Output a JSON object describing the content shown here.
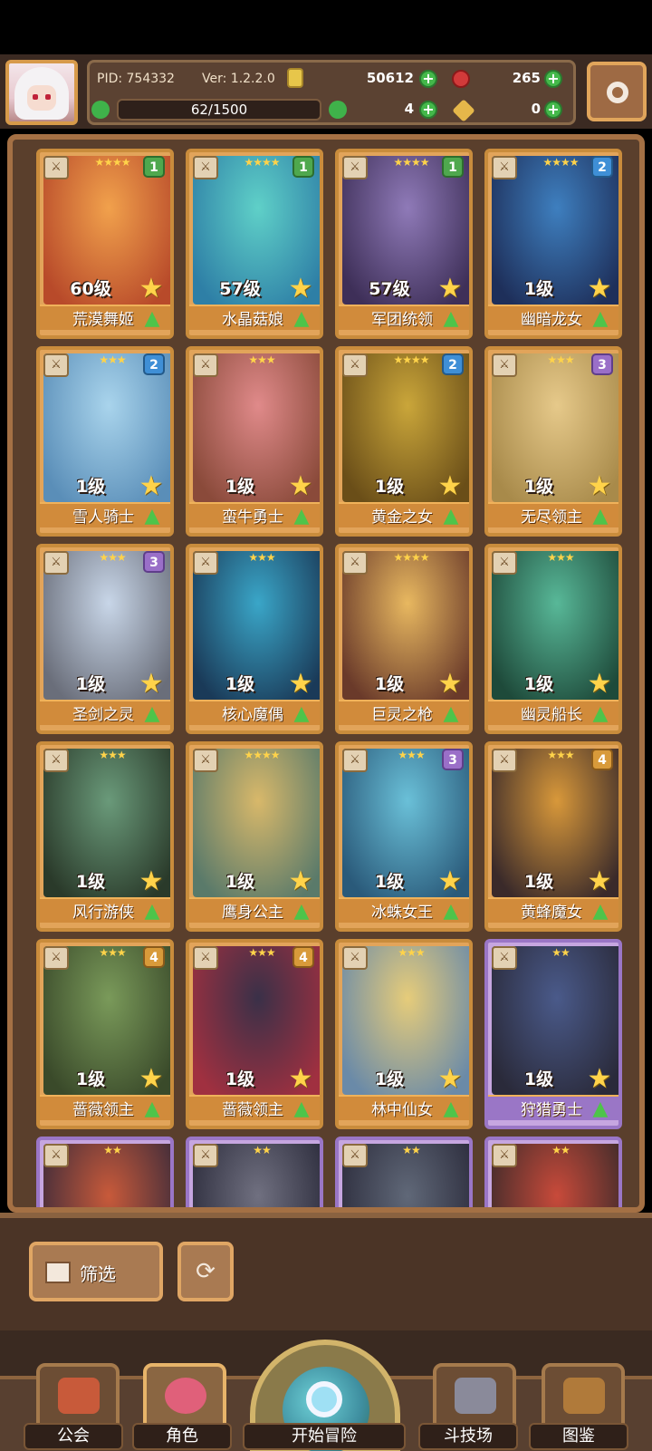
{
  "player": {
    "pid": "PID: 754332",
    "version": "Ver: 1.2.2.0",
    "coins": "50612",
    "gems": "265",
    "stamina": "62/1500",
    "clovers": "4",
    "keys": "0"
  },
  "icons": {
    "settings": "gear-icon",
    "coin": "gold-coin-icon",
    "gem": "red-gem-icon",
    "clover": "clover-icon",
    "key": "key-icon"
  },
  "colors": {
    "card_gold_border": "#c98c3c",
    "card_purple_border": "#9a76c6",
    "badge_green": "#4fa84e",
    "badge_blue": "#3f8fd6",
    "badge_purple": "#9a6fc8",
    "badge_gold": "#d89a3a"
  },
  "cards": [
    {
      "level": "60级",
      "name": "荒漠舞姬",
      "stars": "★★★★",
      "badge": "1",
      "rarity": "gold"
    },
    {
      "level": "57级",
      "name": "水晶菇娘",
      "stars": "★★★★",
      "badge": "1",
      "rarity": "gold"
    },
    {
      "level": "57级",
      "name": "军团统领",
      "stars": "★★★★",
      "badge": "1",
      "rarity": "gold"
    },
    {
      "level": "1级",
      "name": "幽暗龙女",
      "stars": "★★★★",
      "badge": "2",
      "rarity": "gold"
    },
    {
      "level": "1级",
      "name": "雪人骑士",
      "stars": "★★★",
      "badge": "2",
      "rarity": "gold"
    },
    {
      "level": "1级",
      "name": "蛮牛勇士",
      "stars": "★★★",
      "badge": "",
      "rarity": "gold"
    },
    {
      "level": "1级",
      "name": "黄金之女",
      "stars": "★★★★",
      "badge": "2",
      "rarity": "gold"
    },
    {
      "level": "1级",
      "name": "无尽领主",
      "stars": "★★★",
      "badge": "3",
      "rarity": "gold"
    },
    {
      "level": "1级",
      "name": "圣剑之灵",
      "stars": "★★★",
      "badge": "3",
      "rarity": "gold"
    },
    {
      "level": "1级",
      "name": "核心魔偶",
      "stars": "★★★",
      "badge": "",
      "rarity": "gold"
    },
    {
      "level": "1级",
      "name": "巨灵之枪",
      "stars": "★★★★",
      "badge": "",
      "rarity": "gold"
    },
    {
      "level": "1级",
      "name": "幽灵船长",
      "stars": "★★★",
      "badge": "",
      "rarity": "gold"
    },
    {
      "level": "1级",
      "name": "风行游侠",
      "stars": "★★★",
      "badge": "",
      "rarity": "gold"
    },
    {
      "level": "1级",
      "name": "鹰身公主",
      "stars": "★★★★",
      "badge": "",
      "rarity": "gold"
    },
    {
      "level": "1级",
      "name": "冰蛛女王",
      "stars": "★★★",
      "badge": "3",
      "rarity": "gold"
    },
    {
      "level": "1级",
      "name": "黄蜂魔女",
      "stars": "★★★",
      "badge": "4",
      "rarity": "gold"
    },
    {
      "level": "1级",
      "name": "蔷薇领主",
      "stars": "★★★",
      "badge": "4",
      "rarity": "gold"
    },
    {
      "level": "1级",
      "name": "蔷薇领主",
      "stars": "★★★",
      "badge": "4",
      "rarity": "gold"
    },
    {
      "level": "1级",
      "name": "林中仙女",
      "stars": "★★★",
      "badge": "",
      "rarity": "gold"
    },
    {
      "level": "1级",
      "name": "狩猎勇士",
      "stars": "★★",
      "badge": "",
      "rarity": "purple"
    },
    {
      "level": "",
      "name": "",
      "stars": "★★",
      "badge": "",
      "rarity": "purple"
    },
    {
      "level": "",
      "name": "",
      "stars": "★★",
      "badge": "",
      "rarity": "purple"
    },
    {
      "level": "",
      "name": "",
      "stars": "★★",
      "badge": "",
      "rarity": "purple"
    },
    {
      "level": "",
      "name": "",
      "stars": "★★",
      "badge": "",
      "rarity": "purple"
    }
  ],
  "controls": {
    "filter_label": "筛选"
  },
  "nav": {
    "guild": "公会",
    "character": "角色",
    "start": "开始冒险",
    "arena": "斗技场",
    "codex": "图鉴"
  }
}
